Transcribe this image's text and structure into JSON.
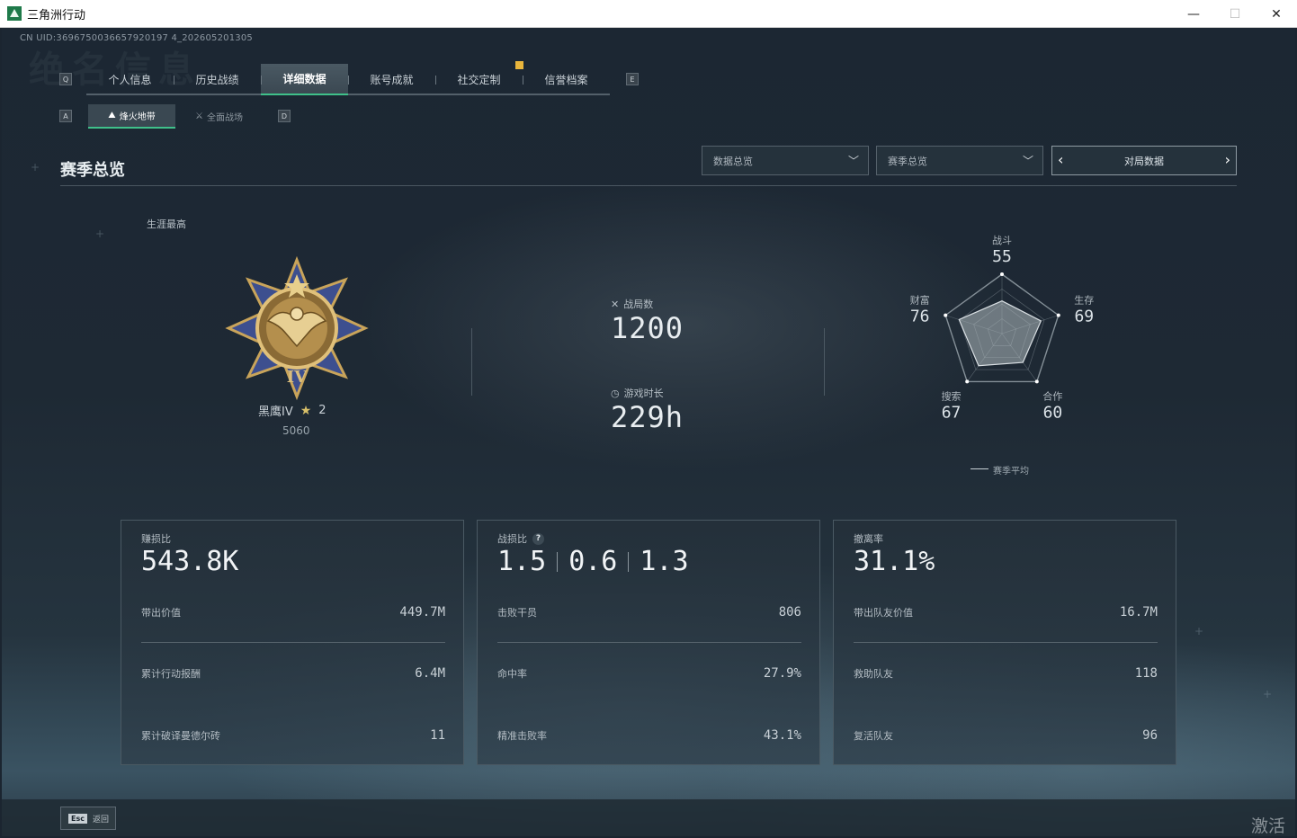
{
  "window": {
    "title": "三角洲行动",
    "controls": {
      "minimize": "—",
      "maximize": "☐",
      "close": "✕"
    }
  },
  "uid_text": "CN UID:3696750036657920197 4_202605201305",
  "watermark": "绝名信息",
  "top_tabs": {
    "key_left": "Q",
    "key_right": "E",
    "items": [
      {
        "label": "个人信息"
      },
      {
        "label": "历史战绩"
      },
      {
        "label": "详细数据",
        "active": true
      },
      {
        "label": "账号成就"
      },
      {
        "label": "社交定制"
      },
      {
        "label": "信誉档案"
      }
    ]
  },
  "sub_tabs": {
    "key_left": "A",
    "key_right": "D",
    "items": [
      {
        "label": "烽火地带",
        "icon": "outpost-icon",
        "active": true
      },
      {
        "label": "全面战场",
        "icon": "battlefield-icon"
      }
    ]
  },
  "section": {
    "title": "赛季总览"
  },
  "filters": {
    "data_dropdown": "数据总览",
    "season_dropdown": "赛季总览",
    "pager_label": "对局数据"
  },
  "rank": {
    "career_label": "生涯最高",
    "name": "黑鹰IV",
    "stars": "2",
    "score": "5060",
    "medal_numeral": "IV"
  },
  "middle": {
    "matches_label": "战局数",
    "matches_value": "1200",
    "playtime_label": "游戏时长",
    "playtime_value": "229h"
  },
  "radar": {
    "axes": [
      {
        "label": "战斗",
        "value": "55"
      },
      {
        "label": "生存",
        "value": "69"
      },
      {
        "label": "合作",
        "value": "60"
      },
      {
        "label": "搜索",
        "value": "67"
      },
      {
        "label": "财富",
        "value": "76"
      }
    ],
    "legend": "赛季平均"
  },
  "cards": [
    {
      "label": "赚损比",
      "big": "543.8K",
      "rows": [
        {
          "key": "带出价值",
          "value": "449.7M"
        },
        {
          "key": "累计行动报酬",
          "value": "6.4M"
        },
        {
          "key": "累计破译曼德尔砖",
          "value": "11"
        }
      ]
    },
    {
      "label": "战损比",
      "help": "?",
      "big_parts": [
        "1.5",
        "0.6",
        "1.3"
      ],
      "rows": [
        {
          "key": "击败干员",
          "value": "806"
        },
        {
          "key": "命中率",
          "value": "27.9%"
        },
        {
          "key": "精准击败率",
          "value": "43.1%"
        }
      ]
    },
    {
      "label": "撤离率",
      "big": "31.1%",
      "rows": [
        {
          "key": "带出队友价值",
          "value": "16.7M"
        },
        {
          "key": "救助队友",
          "value": "118"
        },
        {
          "key": "复活队友",
          "value": "96"
        }
      ]
    }
  ],
  "footer": {
    "esc_key": "Esc",
    "esc_label": "返回"
  },
  "activate_text": "激活 W",
  "colors": {
    "accent_green": "#3fc08a",
    "badge_yellow": "#e9b63c",
    "medal_gold": "#c9a45a",
    "medal_blue": "#3d4f8f"
  }
}
